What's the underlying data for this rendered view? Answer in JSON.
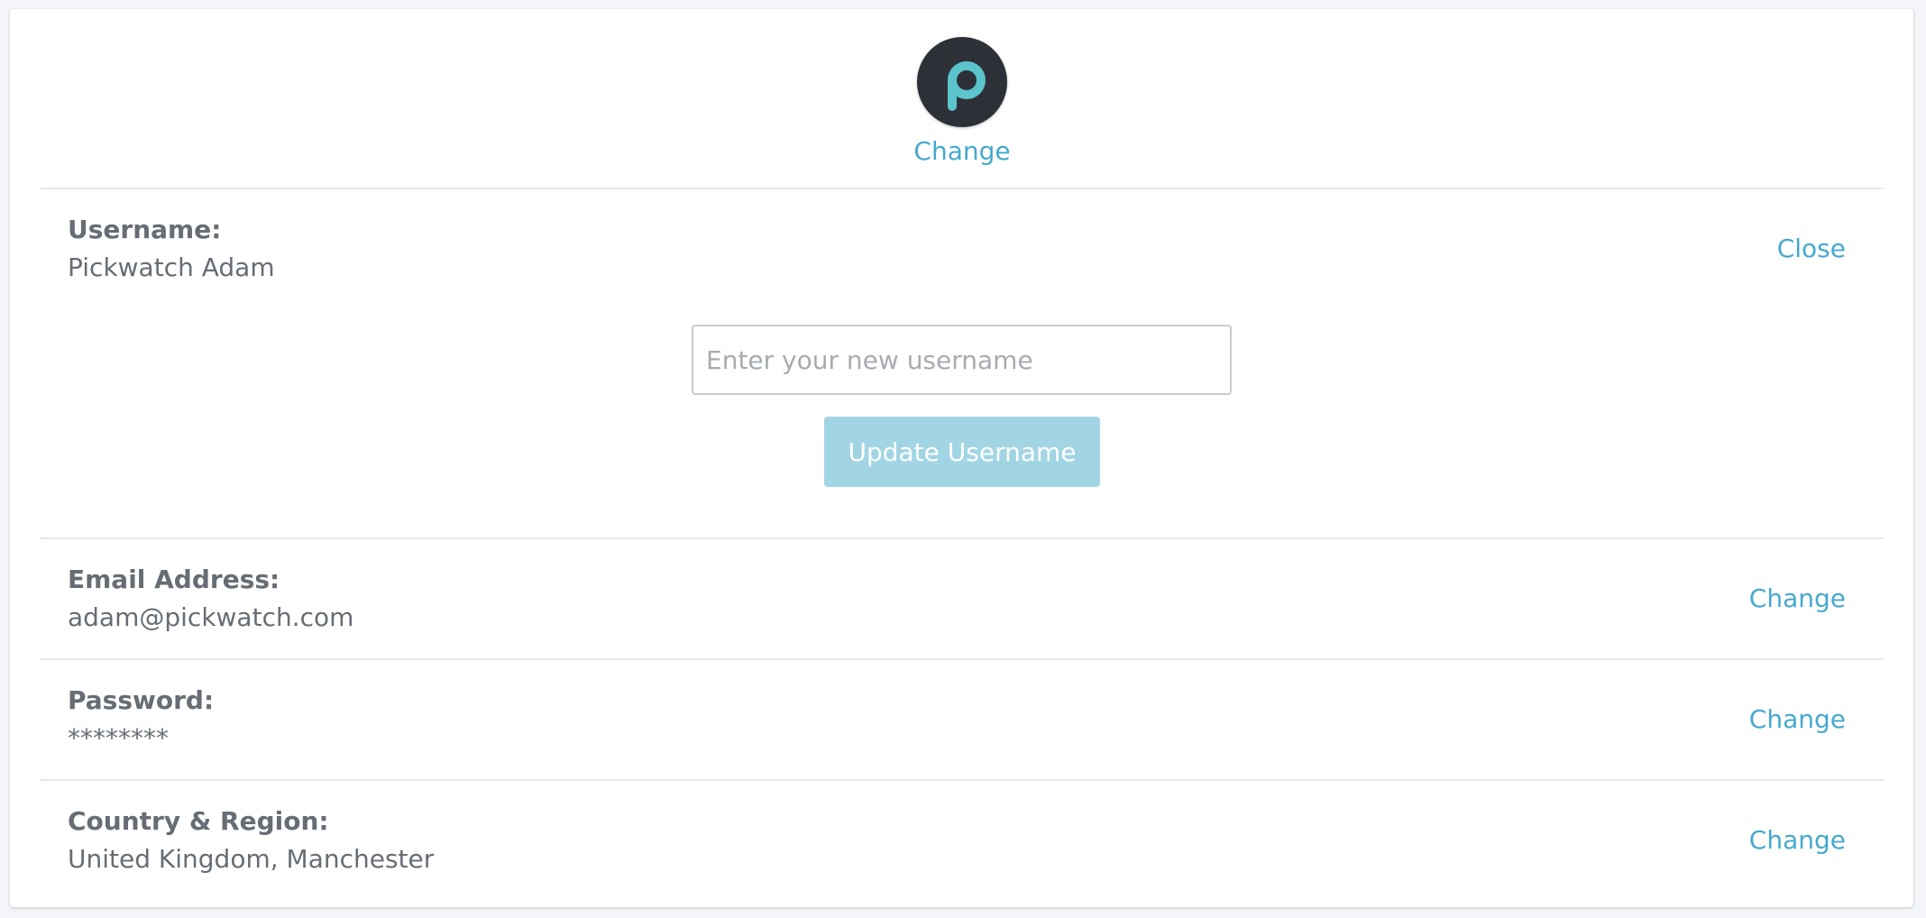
{
  "avatar": {
    "change_label": "Change",
    "logo_color": "#5cc4cc",
    "background_color": "#2d3137"
  },
  "username": {
    "label": "Username:",
    "value": "Pickwatch Adam",
    "action_label": "Close",
    "input_placeholder": "Enter your new username",
    "input_value": "",
    "submit_label": "Update Username"
  },
  "email": {
    "label": "Email Address:",
    "value": "adam@pickwatch.com",
    "action_label": "Change"
  },
  "password": {
    "label": "Password:",
    "value": "********",
    "action_label": "Change"
  },
  "location": {
    "label": "Country & Region:",
    "value": "United Kingdom, Manchester",
    "action_label": "Change"
  },
  "colors": {
    "accent": "#46a9cd",
    "button_disabled": "#a2d5e3",
    "text": "#676d74",
    "divider": "#e6e7ea"
  }
}
